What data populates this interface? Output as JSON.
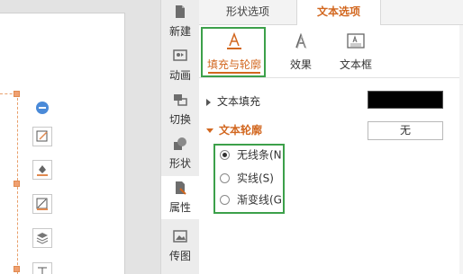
{
  "panel": {
    "top_tabs": {
      "shape_options": "形状选项",
      "text_options": "文本选项"
    },
    "sub_tabs": {
      "fill_outline": "填充与轮廓",
      "effect": "效果",
      "textbox": "文本框"
    },
    "text_fill": {
      "label": "文本填充",
      "color": "#000000"
    },
    "text_outline": {
      "label": "文本轮廓",
      "button_label": "无",
      "options": [
        "无线条(N",
        "实线(S)",
        "渐变线(G"
      ],
      "selected": "无线条(N"
    }
  },
  "side_tabs": {
    "new": "新建",
    "animation": "动画",
    "transition": "切换",
    "shape": "形状",
    "properties": "属性",
    "image": "传图"
  },
  "icons": {
    "new": "file-icon",
    "animation": "animation-icon",
    "transition": "transition-icon",
    "shape": "shape-icon",
    "properties": "properties-icon",
    "image": "image-icon",
    "fill_outline": "text-underline-a-icon",
    "effect": "text-effect-a-icon",
    "textbox": "textbox-icon"
  },
  "colors": {
    "accent": "#d2671f",
    "highlight_box": "#3ca04a",
    "handle": "#f0a070",
    "minus_button": "#4a8ad8"
  }
}
